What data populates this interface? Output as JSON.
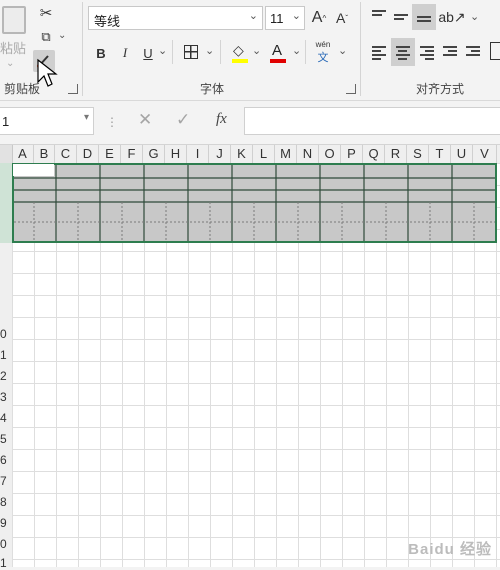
{
  "ribbon": {
    "clipboard": {
      "paste_label": "粘贴",
      "group_label": "剪贴板"
    },
    "font": {
      "font_name": "等线",
      "font_size": "11",
      "group_label": "字体",
      "bold": "B",
      "italic": "I",
      "underline": "U",
      "font_color_letter": "A",
      "phonetic_top": "wén",
      "phonetic_bottom": "文"
    },
    "alignment": {
      "group_label": "对齐方式"
    },
    "font_color_bar": "#e00000",
    "fill_color_bar": "#ffff00"
  },
  "formula_bar": {
    "name_box": "1",
    "fx": "fx"
  },
  "columns": [
    "A",
    "B",
    "C",
    "D",
    "E",
    "F",
    "G",
    "H",
    "I",
    "J",
    "K",
    "L",
    "M",
    "N",
    "O",
    "P",
    "Q",
    "R",
    "S",
    "T",
    "U",
    "V"
  ],
  "rows": [
    "0",
    "1",
    "2",
    "3",
    "4",
    "5",
    "6",
    "7",
    "8",
    "9",
    "0",
    "1"
  ],
  "watermark": "Baidu 经验"
}
